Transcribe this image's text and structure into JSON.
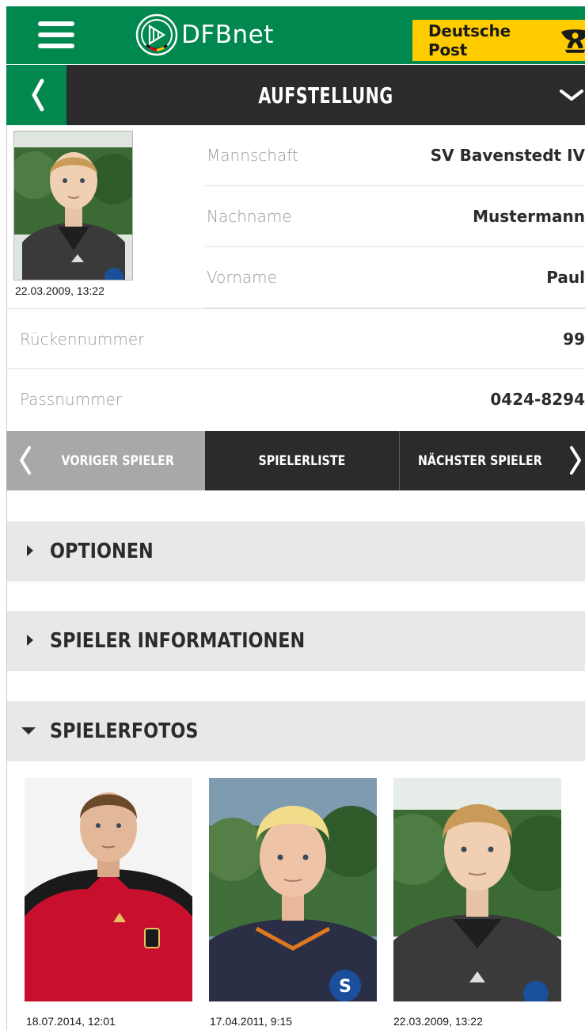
{
  "app": {
    "logo_text": "DFBnet",
    "sponsor_text": "Deutsche Post"
  },
  "header": {
    "title": "AUFSTELLUNG"
  },
  "player": {
    "photo_date": "22.03.2009, 13:22",
    "fields": [
      {
        "label": "Mannschaft",
        "value": "SV Bavenstedt IV"
      },
      {
        "label": "Nachname",
        "value": "Mustermann"
      },
      {
        "label": "Vorname",
        "value": "Paul"
      },
      {
        "label": "Rückennummer",
        "value": "99"
      },
      {
        "label": "Passnummer",
        "value": "0424-8294"
      }
    ]
  },
  "player_nav": {
    "prev_label": "VORIGER SPIELER",
    "list_label": "SPIELERLISTE",
    "next_label": "NÄCHSTER SPIELER"
  },
  "sections": [
    {
      "title": "OPTIONEN",
      "expanded": false
    },
    {
      "title": "SPIELER INFORMATIONEN",
      "expanded": false
    },
    {
      "title": "SPIELERFOTOS",
      "expanded": true
    }
  ],
  "photos": [
    {
      "caption": "18.07.2014, 12:01",
      "jersey": "red"
    },
    {
      "caption": "17.04.2011, 9:15",
      "jersey": "navy"
    },
    {
      "caption": "22.03.2009, 13:22",
      "jersey": "grey"
    }
  ],
  "colors": {
    "brand_green": "#00884f",
    "dark": "#2b2b2b",
    "sponsor_yellow": "#ffcc00",
    "section_bg": "#e8e8e8",
    "inactive_nav": "#a8a8a8"
  },
  "icons": [
    "menu-icon",
    "dfb-logo-icon",
    "post-horn-icon",
    "chevron-left-icon",
    "chevron-down-icon",
    "chevron-right-icon",
    "caret-right-icon",
    "caret-down-icon"
  ]
}
